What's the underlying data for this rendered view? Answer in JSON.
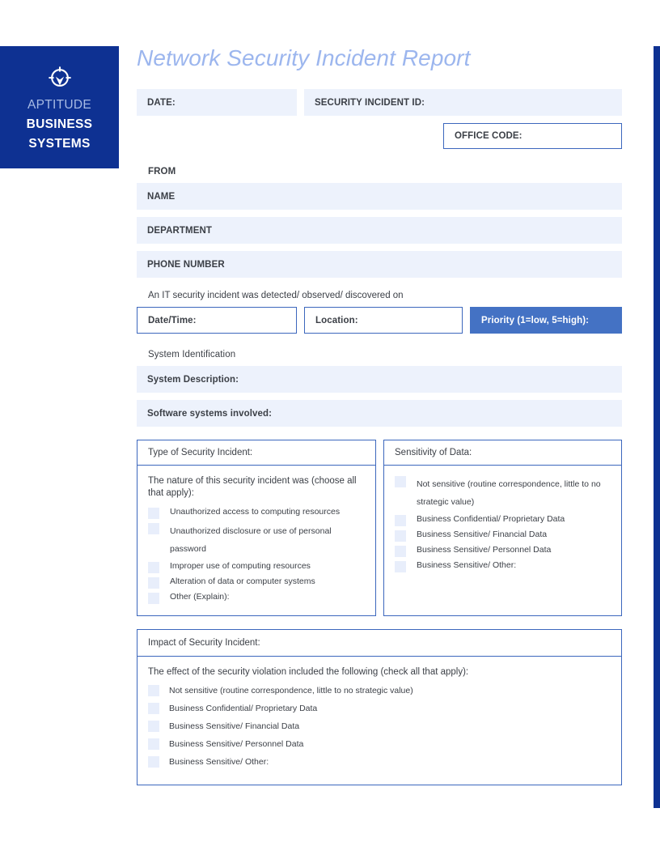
{
  "brand": {
    "icon": "crosshair-target-icon",
    "line1": "APTITUDE",
    "line2": "BUSINESS",
    "line3": "SYSTEMS",
    "color": "#0e3192"
  },
  "title": "Network Security Incident Report",
  "title_color": "#9cb6ee",
  "accent_color": "#4472c4",
  "fill_color": "#edf2fc",
  "border_color": "#3c67bd",
  "header": {
    "date_label": "DATE:",
    "incident_id_label": "SECURITY INCIDENT ID:",
    "office_code_label": "OFFICE CODE:"
  },
  "from": {
    "heading": "FROM",
    "rows": [
      {
        "label": "NAME"
      },
      {
        "label": "DEPARTMENT"
      },
      {
        "label": "PHONE NUMBER"
      }
    ]
  },
  "detection": {
    "note": "An IT security incident was detected/ observed/ discovered on",
    "datetime_label": "Date/Time:",
    "location_label": "Location:",
    "priority_label": "Priority (1=low, 5=high):"
  },
  "system_identification": {
    "heading": "System Identification",
    "rows": [
      {
        "label": "System Description:"
      },
      {
        "label": "Software systems involved:"
      }
    ]
  },
  "type_panel": {
    "heading": "Type of Security Incident:",
    "prompt": "The nature of this security incident was (choose all that apply):",
    "options": [
      "Unauthorized access to computing resources",
      "Unauthorized disclosure or use of personal password",
      "Improper use of computing resources",
      "Alteration of data or computer systems",
      "Other (Explain):"
    ]
  },
  "sensitivity_panel": {
    "heading": "Sensitivity of Data:",
    "options": [
      "Not sensitive (routine correspondence, little to no strategic value)",
      "Business Confidential/ Proprietary Data",
      "Business Sensitive/ Financial Data",
      "Business Sensitive/ Personnel Data",
      "Business Sensitive/ Other:"
    ]
  },
  "impact_panel": {
    "heading": "Impact of Security Incident:",
    "prompt": "The effect of the security violation included the following (check all that apply):",
    "options": [
      "Not sensitive (routine correspondence, little to no strategic value)",
      "Business Confidential/ Proprietary Data",
      "Business Sensitive/ Financial Data",
      "Business Sensitive/ Personnel Data",
      "Business Sensitive/ Other:"
    ]
  }
}
